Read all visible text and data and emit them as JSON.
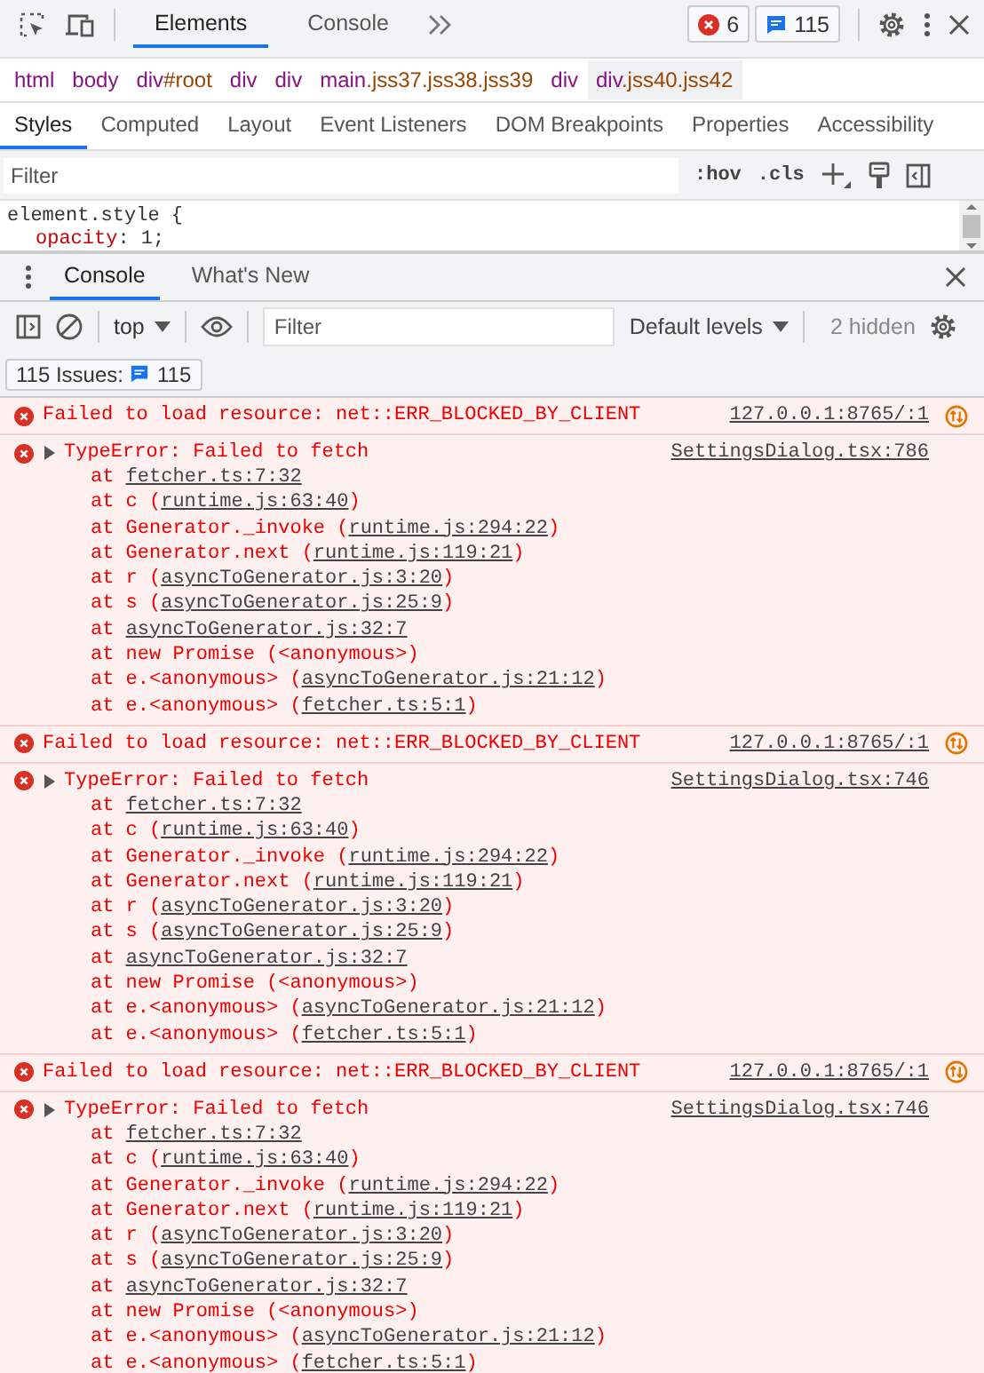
{
  "toolbar": {
    "tabs": [
      {
        "label": "Elements",
        "selected": true
      },
      {
        "label": "Console",
        "selected": false
      }
    ],
    "errors": "6",
    "messages": "115"
  },
  "breadcrumbs": [
    {
      "tag": "html",
      "selected": false
    },
    {
      "tag": "body",
      "selected": false
    },
    {
      "tag": "div",
      "rest": "#root",
      "selected": false
    },
    {
      "tag": "div",
      "selected": false
    },
    {
      "tag": "div",
      "selected": false
    },
    {
      "tag": "main",
      "rest": ".jss37.jss38.jss39",
      "selected": false
    },
    {
      "tag": "div",
      "selected": false
    },
    {
      "tag": "div",
      "rest": ".jss40.jss42",
      "selected": true
    }
  ],
  "styles_tabs": [
    {
      "label": "Styles",
      "selected": true
    },
    {
      "label": "Computed",
      "selected": false
    },
    {
      "label": "Layout",
      "selected": false
    },
    {
      "label": "Event Listeners",
      "selected": false
    },
    {
      "label": "DOM Breakpoints",
      "selected": false
    },
    {
      "label": "Properties",
      "selected": false
    },
    {
      "label": "Accessibility",
      "selected": false
    }
  ],
  "styles_filter": {
    "placeholder": "Filter"
  },
  "style_buttons": [
    ":hov",
    ".cls"
  ],
  "rule": {
    "selector": "element.style",
    "brace": "{",
    "property": "opacity",
    "rest": ": 1;"
  },
  "drawer": {
    "tabs": [
      {
        "label": "Console",
        "selected": true
      },
      {
        "label": "What's New",
        "selected": false
      }
    ]
  },
  "console_toolbar": {
    "context": "top",
    "filter": {
      "placeholder": "Filter"
    },
    "levels": "Default levels",
    "hidden": "2 hidden"
  },
  "issues": {
    "label": "115 Issues:",
    "count": "115"
  },
  "messages": [
    {
      "kind": "resource",
      "text": "Failed to load resource: net::ERR_BLOCKED_BY_CLIENT",
      "source": "127.0.0.1:8765/:1"
    },
    {
      "kind": "exception",
      "text": "TypeError: Failed to fetch",
      "source": "SettingsDialog.tsx:786",
      "stack": [
        [
          {
            "t": "at ",
            "link": false
          },
          {
            "t": "fetcher.ts:7:32",
            "link": true
          }
        ],
        [
          {
            "t": "at c (",
            "link": false
          },
          {
            "t": "runtime.js:63:40",
            "link": true
          },
          {
            "t": ")",
            "link": false
          }
        ],
        [
          {
            "t": "at Generator._invoke (",
            "link": false
          },
          {
            "t": "runtime.js:294:22",
            "link": true
          },
          {
            "t": ")",
            "link": false
          }
        ],
        [
          {
            "t": "at Generator.next (",
            "link": false
          },
          {
            "t": "runtime.js:119:21",
            "link": true
          },
          {
            "t": ")",
            "link": false
          }
        ],
        [
          {
            "t": "at r (",
            "link": false
          },
          {
            "t": "asyncToGenerator.js:3:20",
            "link": true
          },
          {
            "t": ")",
            "link": false
          }
        ],
        [
          {
            "t": "at s (",
            "link": false
          },
          {
            "t": "asyncToGenerator.js:25:9",
            "link": true
          },
          {
            "t": ")",
            "link": false
          }
        ],
        [
          {
            "t": "at ",
            "link": false
          },
          {
            "t": "asyncToGenerator.js:32:7",
            "link": true
          }
        ],
        [
          {
            "t": "at new Promise (<anonymous>)",
            "link": false
          }
        ],
        [
          {
            "t": "at e.<anonymous> (",
            "link": false
          },
          {
            "t": "asyncToGenerator.js:21:12",
            "link": true
          },
          {
            "t": ")",
            "link": false
          }
        ],
        [
          {
            "t": "at e.<anonymous> (",
            "link": false
          },
          {
            "t": "fetcher.ts:5:1",
            "link": true
          },
          {
            "t": ")",
            "link": false
          }
        ]
      ]
    },
    {
      "kind": "resource",
      "text": "Failed to load resource: net::ERR_BLOCKED_BY_CLIENT",
      "source": "127.0.0.1:8765/:1"
    },
    {
      "kind": "exception",
      "text": "TypeError: Failed to fetch",
      "source": "SettingsDialog.tsx:746",
      "stack": [
        [
          {
            "t": "at ",
            "link": false
          },
          {
            "t": "fetcher.ts:7:32",
            "link": true
          }
        ],
        [
          {
            "t": "at c (",
            "link": false
          },
          {
            "t": "runtime.js:63:40",
            "link": true
          },
          {
            "t": ")",
            "link": false
          }
        ],
        [
          {
            "t": "at Generator._invoke (",
            "link": false
          },
          {
            "t": "runtime.js:294:22",
            "link": true
          },
          {
            "t": ")",
            "link": false
          }
        ],
        [
          {
            "t": "at Generator.next (",
            "link": false
          },
          {
            "t": "runtime.js:119:21",
            "link": true
          },
          {
            "t": ")",
            "link": false
          }
        ],
        [
          {
            "t": "at r (",
            "link": false
          },
          {
            "t": "asyncToGenerator.js:3:20",
            "link": true
          },
          {
            "t": ")",
            "link": false
          }
        ],
        [
          {
            "t": "at s (",
            "link": false
          },
          {
            "t": "asyncToGenerator.js:25:9",
            "link": true
          },
          {
            "t": ")",
            "link": false
          }
        ],
        [
          {
            "t": "at ",
            "link": false
          },
          {
            "t": "asyncToGenerator.js:32:7",
            "link": true
          }
        ],
        [
          {
            "t": "at new Promise (<anonymous>)",
            "link": false
          }
        ],
        [
          {
            "t": "at e.<anonymous> (",
            "link": false
          },
          {
            "t": "asyncToGenerator.js:21:12",
            "link": true
          },
          {
            "t": ")",
            "link": false
          }
        ],
        [
          {
            "t": "at e.<anonymous> (",
            "link": false
          },
          {
            "t": "fetcher.ts:5:1",
            "link": true
          },
          {
            "t": ")",
            "link": false
          }
        ]
      ]
    },
    {
      "kind": "resource",
      "text": "Failed to load resource: net::ERR_BLOCKED_BY_CLIENT",
      "source": "127.0.0.1:8765/:1"
    },
    {
      "kind": "exception",
      "text": "TypeError: Failed to fetch",
      "source": "SettingsDialog.tsx:746",
      "stack": [
        [
          {
            "t": "at ",
            "link": false
          },
          {
            "t": "fetcher.ts:7:32",
            "link": true
          }
        ],
        [
          {
            "t": "at c (",
            "link": false
          },
          {
            "t": "runtime.js:63:40",
            "link": true
          },
          {
            "t": ")",
            "link": false
          }
        ],
        [
          {
            "t": "at Generator._invoke (",
            "link": false
          },
          {
            "t": "runtime.js:294:22",
            "link": true
          },
          {
            "t": ")",
            "link": false
          }
        ],
        [
          {
            "t": "at Generator.next (",
            "link": false
          },
          {
            "t": "runtime.js:119:21",
            "link": true
          },
          {
            "t": ")",
            "link": false
          }
        ],
        [
          {
            "t": "at r (",
            "link": false
          },
          {
            "t": "asyncToGenerator.js:3:20",
            "link": true
          },
          {
            "t": ")",
            "link": false
          }
        ],
        [
          {
            "t": "at s (",
            "link": false
          },
          {
            "t": "asyncToGenerator.js:25:9",
            "link": true
          },
          {
            "t": ")",
            "link": false
          }
        ],
        [
          {
            "t": "at ",
            "link": false
          },
          {
            "t": "asyncToGenerator.js:32:7",
            "link": true
          }
        ],
        [
          {
            "t": "at new Promise (<anonymous>)",
            "link": false
          }
        ],
        [
          {
            "t": "at e.<anonymous> (",
            "link": false
          },
          {
            "t": "asyncToGenerator.js:21:12",
            "link": true
          },
          {
            "t": ")",
            "link": false
          }
        ],
        [
          {
            "t": "at e.<anonymous> (",
            "link": false
          },
          {
            "t": "fetcher.ts:5:1",
            "link": true
          },
          {
            "t": ")",
            "link": false
          }
        ]
      ]
    }
  ]
}
